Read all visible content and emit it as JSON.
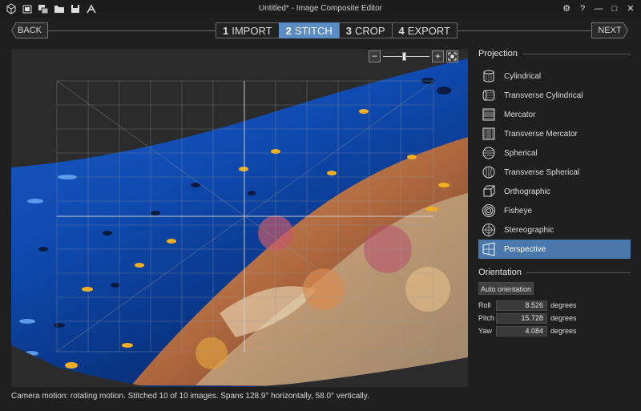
{
  "window": {
    "title": "Untitled* - Image Composite Editor",
    "toolbar_icons": [
      "new-icon",
      "open-icon",
      "add-images-icon",
      "folder-icon",
      "save-icon",
      "publish-icon"
    ],
    "controls": {
      "settings": "⚙",
      "help": "?",
      "minimize": "—",
      "maximize": "□",
      "close": "✕"
    }
  },
  "nav": {
    "back_label": "BACK",
    "next_label": "NEXT",
    "steps": [
      {
        "num": "1",
        "label": "IMPORT"
      },
      {
        "num": "2",
        "label": "STITCH"
      },
      {
        "num": "3",
        "label": "CROP"
      },
      {
        "num": "4",
        "label": "EXPORT"
      }
    ],
    "active_step": "STITCH"
  },
  "zoom": {
    "out": "−",
    "in": "+",
    "level": 0.45
  },
  "status": "Camera motion: rotating motion. Stitched 10 of 10 images. Spans 128.9° horizontally, 58.0° vertically.",
  "projection": {
    "title": "Projection",
    "items": [
      {
        "label": "Cylindrical",
        "icon": "cylindrical-icon"
      },
      {
        "label": "Transverse Cylindrical",
        "icon": "transverse-cylindrical-icon"
      },
      {
        "label": "Mercator",
        "icon": "mercator-icon"
      },
      {
        "label": "Transverse Mercator",
        "icon": "transverse-mercator-icon"
      },
      {
        "label": "Spherical",
        "icon": "spherical-icon"
      },
      {
        "label": "Transverse Spherical",
        "icon": "transverse-spherical-icon"
      },
      {
        "label": "Orthographic",
        "icon": "orthographic-icon"
      },
      {
        "label": "Fisheye",
        "icon": "fisheye-icon"
      },
      {
        "label": "Stereographic",
        "icon": "stereographic-icon"
      },
      {
        "label": "Perspective",
        "icon": "perspective-icon"
      }
    ],
    "selected": "Perspective"
  },
  "orientation": {
    "title": "Orientation",
    "auto_label": "Auto orientation",
    "roll": {
      "label": "Roll",
      "value": "8.526",
      "unit": "degrees"
    },
    "pitch": {
      "label": "Pitch",
      "value": "15.728",
      "unit": "degrees"
    },
    "yaw": {
      "label": "Yaw",
      "value": "4.084",
      "unit": "degrees"
    }
  },
  "colors": {
    "accent": "#5b8cc4",
    "selected": "#4a78ad",
    "ocean_deep": "#0a3a8a",
    "ocean_light": "#2f7fe0",
    "reef": "#c98a4a"
  }
}
